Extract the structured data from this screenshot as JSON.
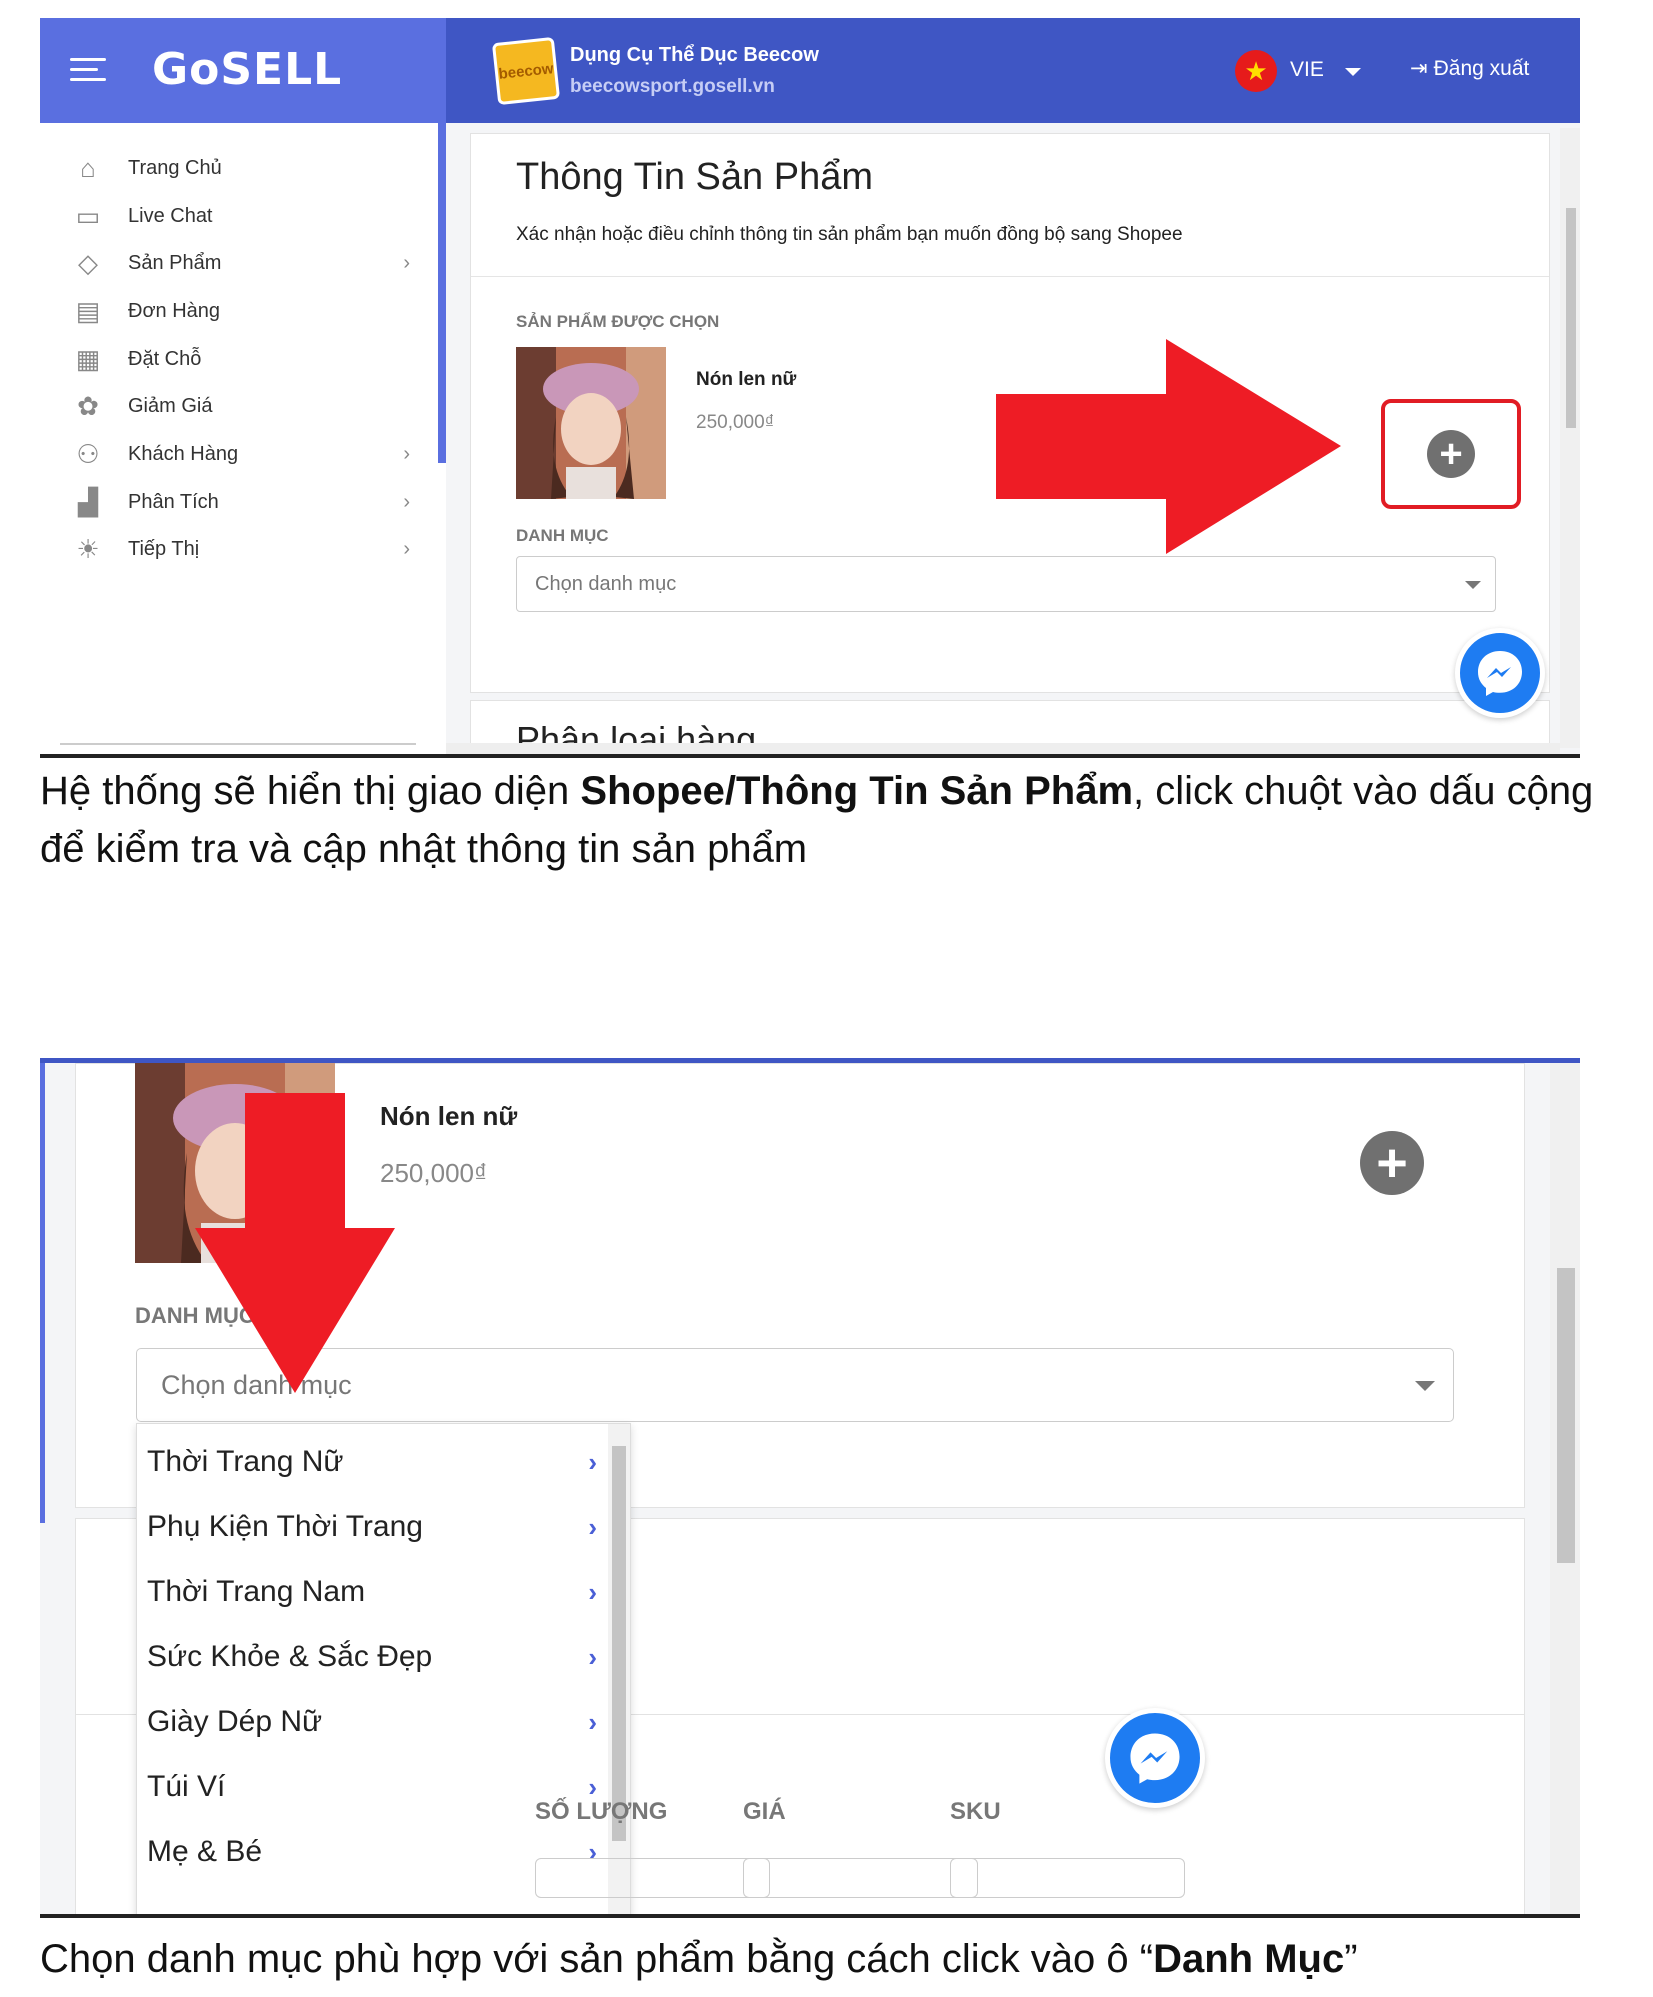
{
  "colors": {
    "brand": "#3f56c4",
    "accent": "#5a6fe0",
    "highlight_red": "#e11c24",
    "messenger": "#1e7cf2"
  },
  "screen1": {
    "header": {
      "logo": "GoSELL",
      "shop_name": "Dụng Cụ Thể Dục Beecow",
      "shop_url": "beecowsport.gosell.vn",
      "shop_logo_text": "beecow",
      "language": "VIE",
      "logout": "Đăng xuất"
    },
    "sidebar": {
      "items": [
        {
          "label": "Trang Chủ",
          "icon": "home-icon",
          "glyph": "⌂"
        },
        {
          "label": "Live Chat",
          "icon": "chat-icon",
          "glyph": "▭"
        },
        {
          "label": "Sản Phẩm",
          "icon": "tag-icon",
          "glyph": "◇",
          "has_submenu": true
        },
        {
          "label": "Đơn Hàng",
          "icon": "receipt-icon",
          "glyph": "▤"
        },
        {
          "label": "Đặt Chỗ",
          "icon": "calendar-icon",
          "glyph": "▦"
        },
        {
          "label": "Giảm Giá",
          "icon": "discount-icon",
          "glyph": "✿"
        },
        {
          "label": "Khách Hàng",
          "icon": "customers-icon",
          "glyph": "⚇",
          "has_submenu": true
        },
        {
          "label": "Phân Tích",
          "icon": "analytics-icon",
          "glyph": "▟",
          "has_submenu": true
        },
        {
          "label": "Tiếp Thị",
          "icon": "bulb-icon",
          "glyph": "☀",
          "has_submenu": true
        }
      ],
      "chevron": "›"
    },
    "content": {
      "title": "Thông Tin Sản Phẩm",
      "subtitle": "Xác nhận hoặc điều chỉnh thông tin sản phẩm bạn muốn đồng bộ sang Shopee",
      "selected_label": "SẢN PHẨM ĐƯỢC CHỌN",
      "product_name": "Nón len nữ",
      "product_price": "250,000₫",
      "category_label": "DANH MỤC",
      "category_placeholder": "Chọn danh mục",
      "next_section_partial": "Phân loại hàng",
      "plus": "+"
    }
  },
  "caption1": {
    "prefix": "Hệ thống sẽ hiển thị giao diện ",
    "bold": "Shopee/Thông Tin Sản Phẩm",
    "suffix": ", click chuột vào dấu cộng để kiểm tra và cập nhật thông tin sản phẩm"
  },
  "screen2": {
    "product_name": "Nón len nữ",
    "product_price": "250,000₫",
    "category_label": "DANH MỤC",
    "category_placeholder": "Chọn danh mục",
    "plus": "+",
    "dropdown": [
      "Thời Trang Nữ",
      "Phụ Kiện Thời Trang",
      "Thời Trang Nam",
      "Sức Khỏe & Sắc Đẹp",
      "Giày Dép Nữ",
      "Túi Ví",
      "Mẹ & Bé"
    ],
    "chevron": "›",
    "columns": [
      "SỐ LƯỢNG",
      "GIÁ",
      "SKU"
    ]
  },
  "caption2": {
    "prefix": "Chọn danh mục phù hợp với sản phẩm bằng cách click vào ô “",
    "bold": "Danh Mục",
    "suffix": "”"
  }
}
